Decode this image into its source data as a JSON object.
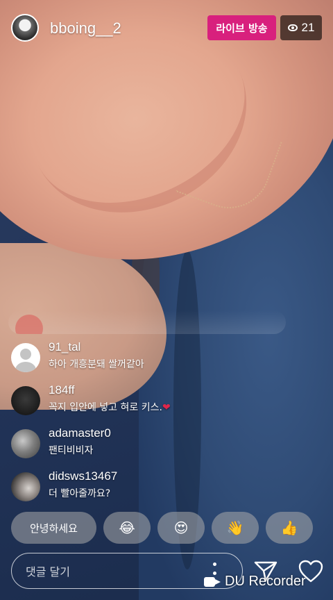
{
  "header": {
    "username": "bboing__2",
    "live_badge": "라이브 방송",
    "viewer_count": "21"
  },
  "comments": [
    {
      "user": "91_tal",
      "text": "하아 개흥분돼 쌀꺼같아",
      "avatar": "default-avatar"
    },
    {
      "user": "184ff",
      "text": "꼭지 입안에 넣고 혀로 키스.",
      "emoji": "❤",
      "avatar": "dark-avatar"
    },
    {
      "user": "adamaster0",
      "text": "팬티비비자",
      "avatar": "photo-avatar"
    },
    {
      "user": "didsws13467",
      "text": "더 빨아줄까요?",
      "avatar": "photo-avatar"
    }
  ],
  "quick_replies": [
    {
      "label": "안녕하세요",
      "type": "text"
    },
    {
      "label": "😂",
      "type": "emoji",
      "icon": "laughing-face-icon"
    },
    {
      "label": "😍",
      "type": "emoji",
      "icon": "heart-eyes-icon"
    },
    {
      "label": "👋",
      "type": "emoji",
      "icon": "waving-hand-icon"
    },
    {
      "label": "👍",
      "type": "emoji",
      "icon": "thumbs-up-icon"
    }
  ],
  "bottom_bar": {
    "comment_placeholder": "댓글 달기",
    "icons": [
      "more-icon",
      "send-icon",
      "heart-icon"
    ]
  },
  "watermark": "DU Recorder",
  "colors": {
    "live_badge": "#d8207d",
    "heart": "#e0264a"
  }
}
